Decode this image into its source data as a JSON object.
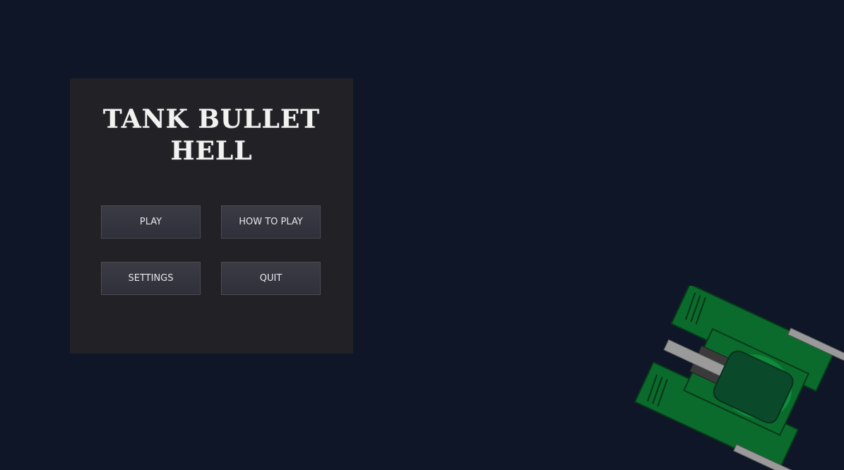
{
  "title": {
    "line1": "TANK BULLET",
    "line2": "HELL"
  },
  "menu": {
    "play_label": "PLAY",
    "how_to_play_label": "HOW TO PLAY",
    "settings_label": "SETTINGS",
    "quit_label": "QUIT"
  },
  "colors": {
    "background": "#0f1627",
    "panel": "#222226",
    "button": "#35353e",
    "tank_body": "#0b6b2c",
    "tank_turret": "#0a4a2a"
  },
  "sprites": {
    "player": "green-tank-sprite"
  }
}
